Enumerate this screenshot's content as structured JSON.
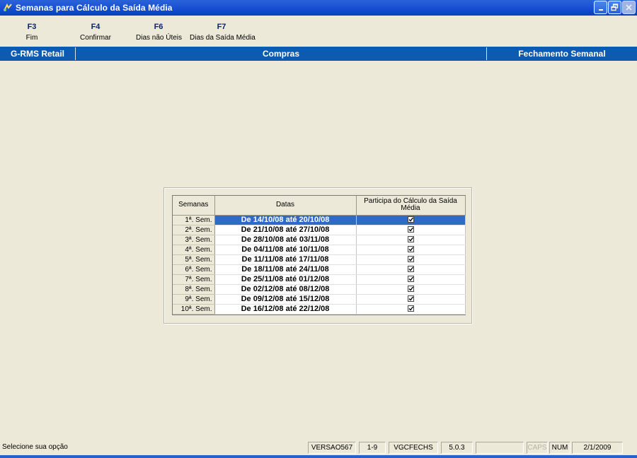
{
  "window": {
    "title": "Semanas para Cálculo da Saída Média"
  },
  "toolbar": {
    "keys": [
      {
        "key": "F3",
        "label": "Fim"
      },
      {
        "key": "F4",
        "label": "Confirmar"
      },
      {
        "key": "F6",
        "label": "Dias não Úteis"
      },
      {
        "key": "F7",
        "label": "Dias da Saída Média"
      }
    ]
  },
  "nav": {
    "left": "G-RMS Retail",
    "center": "Compras",
    "right": "Fechamento Semanal"
  },
  "grid": {
    "headers": {
      "semanas": "Semanas",
      "datas": "Datas",
      "participa": "Participa do Cálculo da Saída Média"
    },
    "rows": [
      {
        "semana": "1ª. Sem.",
        "datas": "De 14/10/08 até 20/10/08",
        "checked": true
      },
      {
        "semana": "2ª. Sem.",
        "datas": "De 21/10/08 até 27/10/08",
        "checked": true
      },
      {
        "semana": "3ª. Sem.",
        "datas": "De 28/10/08 até 03/11/08",
        "checked": true
      },
      {
        "semana": "4ª. Sem.",
        "datas": "De 04/11/08 até 10/11/08",
        "checked": true
      },
      {
        "semana": "5ª. Sem.",
        "datas": "De 11/11/08 até 17/11/08",
        "checked": true
      },
      {
        "semana": "6ª. Sem.",
        "datas": "De 18/11/08 até 24/11/08",
        "checked": true
      },
      {
        "semana": "7ª. Sem.",
        "datas": "De 25/11/08 até 01/12/08",
        "checked": true
      },
      {
        "semana": "8ª. Sem.",
        "datas": "De 02/12/08 até 08/12/08",
        "checked": true
      },
      {
        "semana": "9ª. Sem.",
        "datas": "De 09/12/08 até 15/12/08",
        "checked": true
      },
      {
        "semana": "10ª. Sem.",
        "datas": "De 16/12/08 até 22/12/08",
        "checked": true
      }
    ],
    "selected_row": 1
  },
  "status": {
    "message": "Selecione sua opção",
    "version": "VERSAO567",
    "page": "1-9",
    "program": "VGCFECHS",
    "release": "5.0.3",
    "blank": "",
    "caps": "CAPS",
    "num": "NUM",
    "date": "2/1/2009"
  },
  "colors": {
    "titlebar": "#0b45c8",
    "navbar": "#0b5bb3",
    "selection": "#316ac5",
    "background": "#ece9d8"
  }
}
